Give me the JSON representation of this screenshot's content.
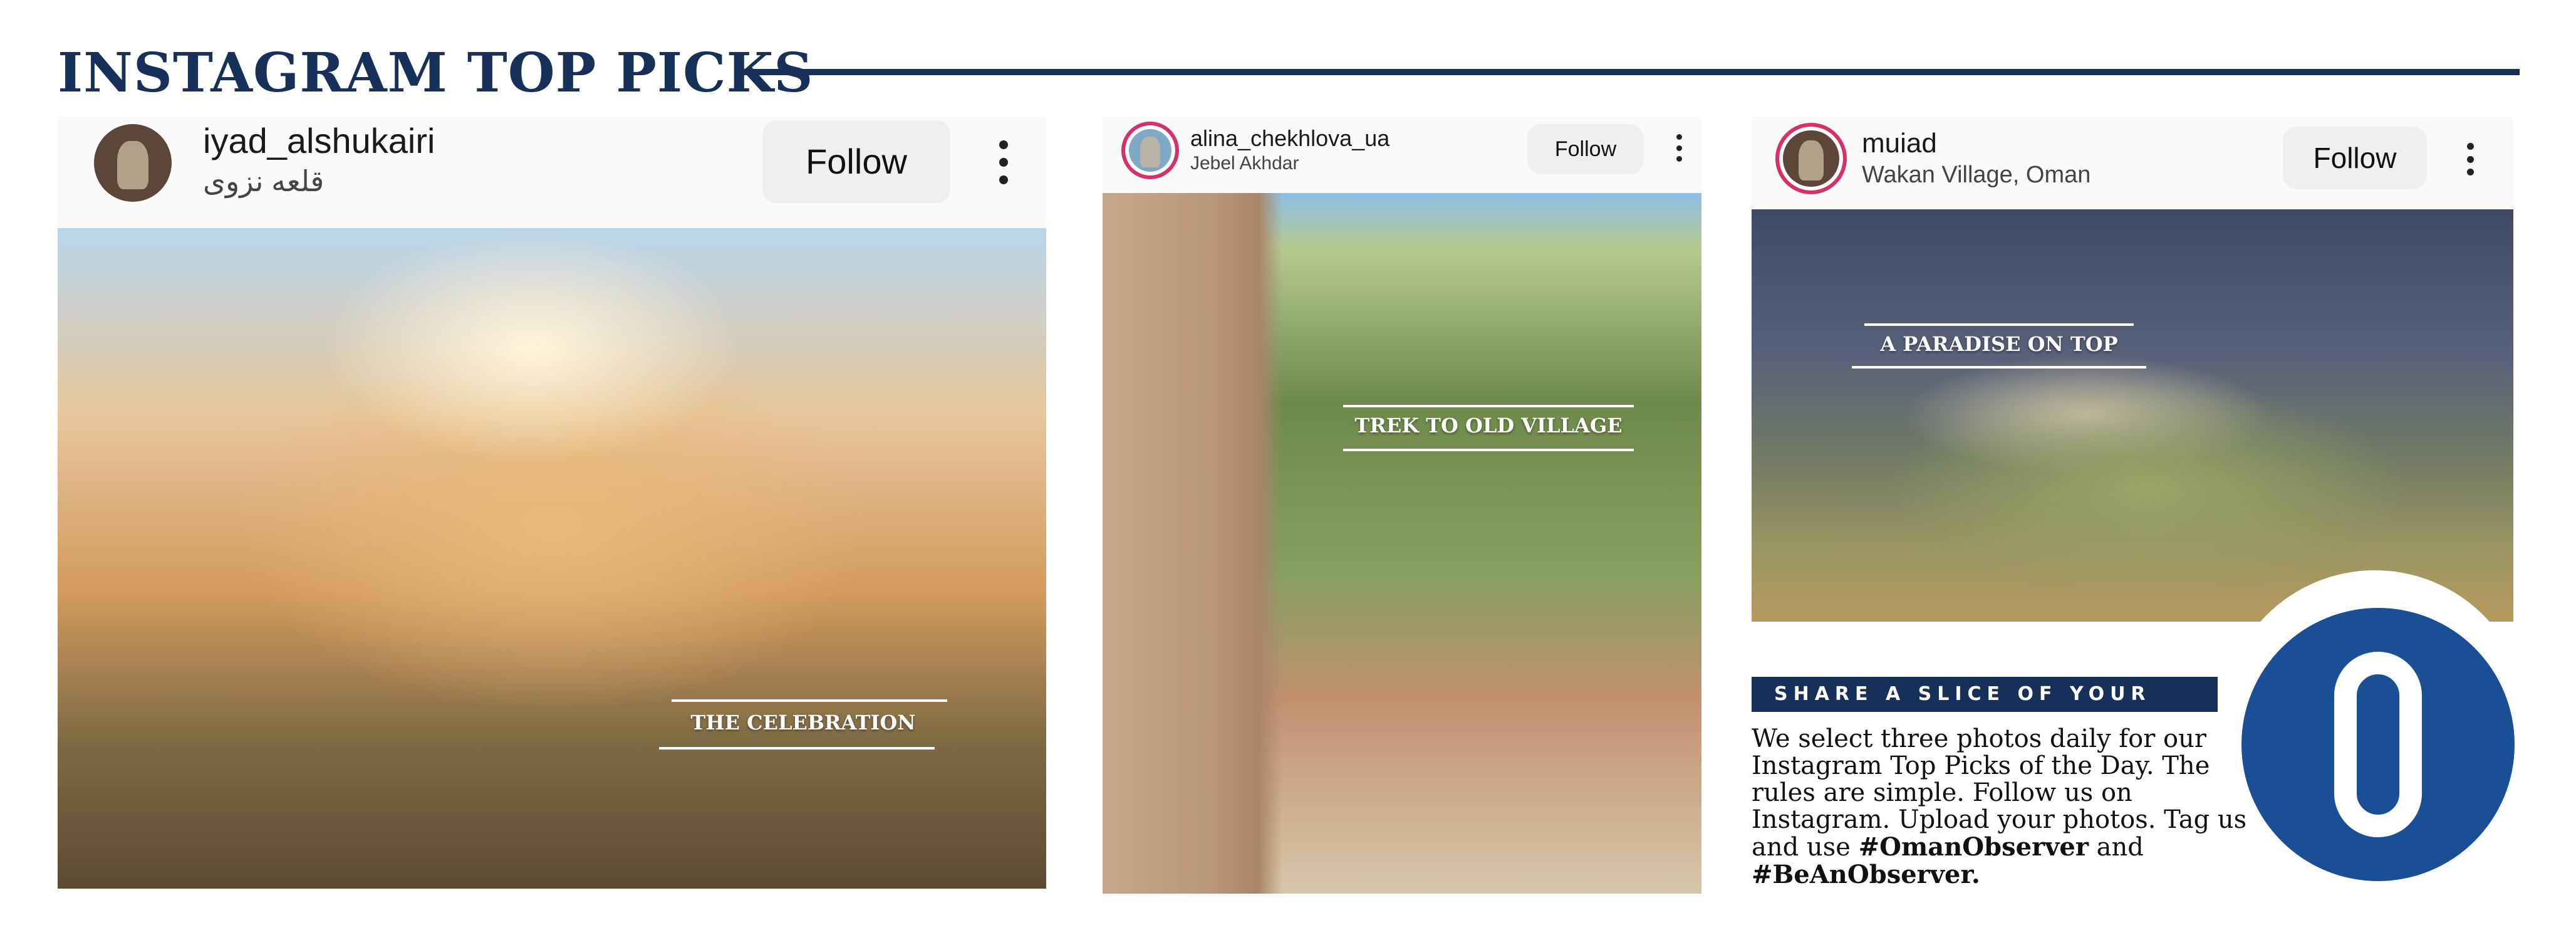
{
  "header": {
    "title": "INSTAGRAM TOP PICKS"
  },
  "posts": [
    {
      "username": "iyad_alshukairi",
      "location": "قلعه نزوى",
      "follow_label": "Follow",
      "more_icon": "more-vertical-icon",
      "caption": "THE CELEBRATION"
    },
    {
      "username": "alina_chekhlova_ua",
      "location": "Jebel Akhdar",
      "follow_label": "Follow",
      "more_icon": "more-vertical-icon",
      "caption": "TREK TO OLD VILLAGE"
    },
    {
      "username": "muiad",
      "location": "Wakan Village, Oman",
      "follow_label": "Follow",
      "more_icon": "more-vertical-icon",
      "caption": "A PARADISE ON TOP"
    }
  ],
  "promo": {
    "banner": "SHARE A SLICE OF YOUR LIFE",
    "body_intro": "We select three photos daily for our Instagram Top Picks of the Day. The rules are simple. Follow us on Instagram. Upload your photos. Tag us and use ",
    "hashtag1": "#OmanObserver",
    "conjunction": " and ",
    "hashtag2": "#BeAnObserver."
  },
  "logo": {
    "letter": "O",
    "brand_color": "#1a4f95"
  },
  "colors": {
    "navy": "#16305a",
    "follow_bg": "#efefef"
  }
}
